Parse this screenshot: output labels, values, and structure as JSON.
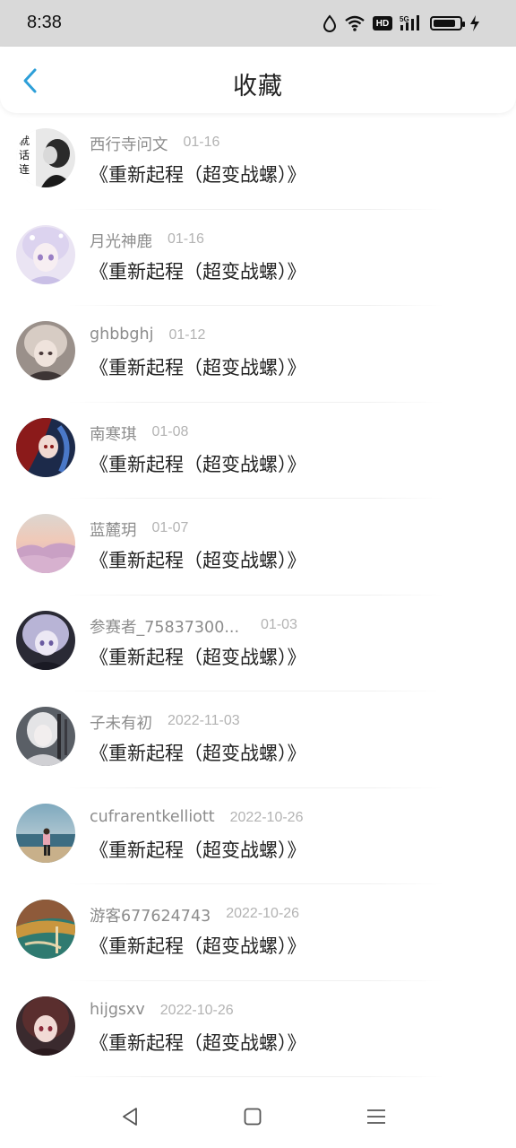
{
  "status_bar": {
    "time": "8:38",
    "hd_label": "HD"
  },
  "header": {
    "title": "收藏",
    "back_icon": "chevron-left-icon",
    "accent_color": "#2d9fd8"
  },
  "items": [
    {
      "name": "西行寺问文",
      "date": "01-16",
      "title": "《重新起程（超变战螺）》"
    },
    {
      "name": "月光神鹿",
      "date": "01-16",
      "title": "《重新起程（超变战螺）》"
    },
    {
      "name": "ghbbghj",
      "date": "01-12",
      "title": "《重新起程（超变战螺）》"
    },
    {
      "name": "南寒琪",
      "date": "01-08",
      "title": "《重新起程（超变战螺）》"
    },
    {
      "name": "蓝麓玥",
      "date": "01-07",
      "title": "《重新起程（超变战螺）》"
    },
    {
      "name": "参赛者_75837300...",
      "date": "01-03",
      "title": "《重新起程（超变战螺）》"
    },
    {
      "name": "子未有初",
      "date": "2022-11-03",
      "title": "《重新起程（超变战螺）》"
    },
    {
      "name": "cufrarentkelliott",
      "date": "2022-10-26",
      "title": "《重新起程（超变战螺）》"
    },
    {
      "name": "游客677624743",
      "date": "2022-10-26",
      "title": "《重新起程（超变战螺）》"
    },
    {
      "name": "hijgsxv",
      "date": "2022-10-26",
      "title": "《重新起程（超变战螺）》"
    }
  ],
  "nav_bar": {
    "icons": [
      "back-triangle-icon",
      "home-square-icon",
      "menu-lines-icon"
    ]
  }
}
